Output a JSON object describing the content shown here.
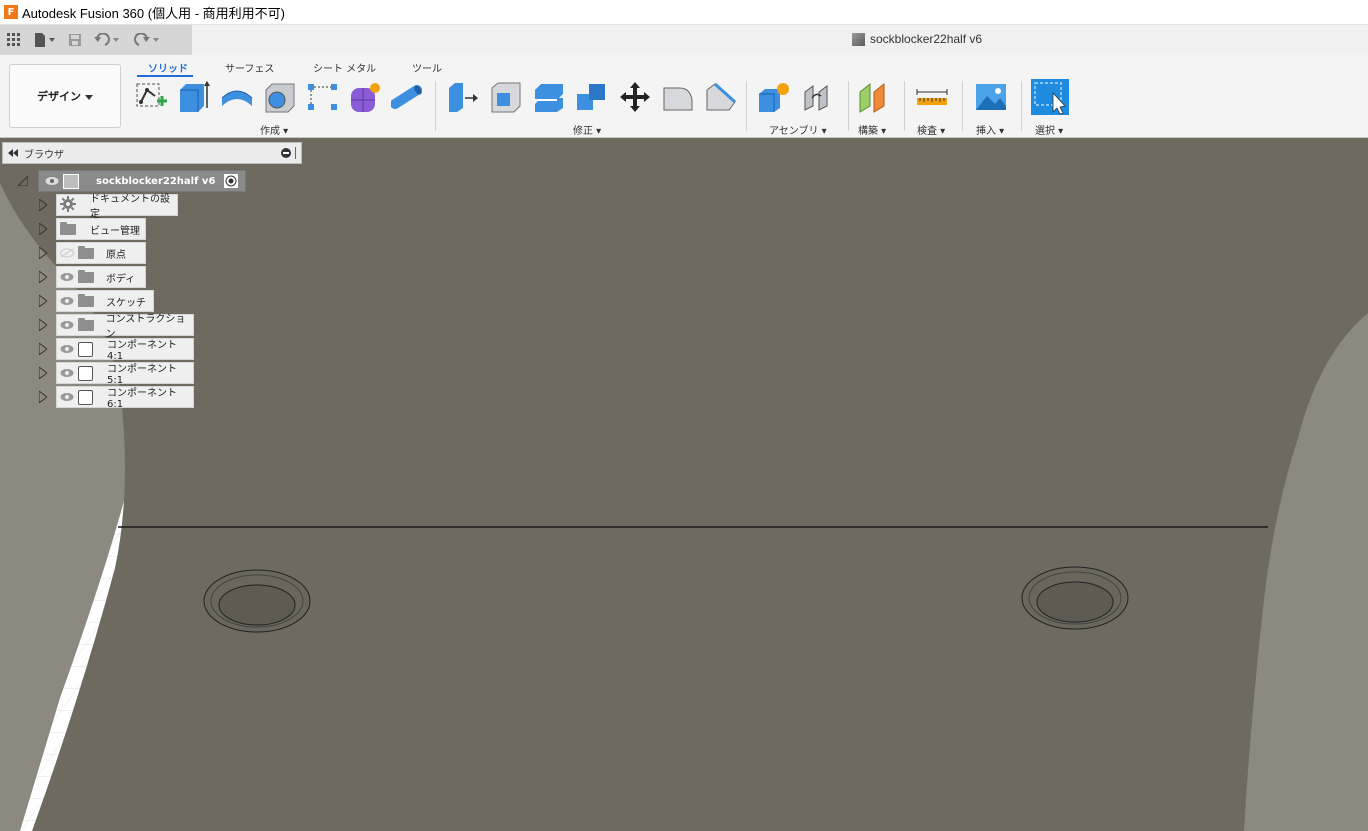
{
  "window": {
    "title": "Autodesk Fusion 360 (個人用 - 商用利用不可)",
    "logo_letter": "F"
  },
  "document_tab": {
    "name": "sockblocker22half v6"
  },
  "workspace": {
    "label": "デザイン"
  },
  "ribbon_tabs": [
    {
      "label": "ソリッド",
      "active": true
    },
    {
      "label": "サーフェス",
      "active": false
    },
    {
      "label": "シート メタル",
      "active": false
    },
    {
      "label": "ツール",
      "active": false
    }
  ],
  "ribbon_groups": {
    "create": "作成",
    "modify": "修正",
    "assemble": "アセンブリ",
    "construct": "構築",
    "inspect": "検査",
    "insert": "挿入",
    "select": "選択"
  },
  "browser": {
    "title": "ブラウザ",
    "root": "sockblocker22half v6",
    "items": [
      {
        "label": "ドキュメントの設定",
        "icon": "gear-icon"
      },
      {
        "label": "ビュー管理",
        "icon": "folder-icon"
      },
      {
        "label": "原点",
        "icon": "folder-icon"
      },
      {
        "label": "ボディ",
        "icon": "folder-icon"
      },
      {
        "label": "スケッチ",
        "icon": "folder-icon"
      },
      {
        "label": "コンストラクション",
        "icon": "folder-icon"
      },
      {
        "label": "コンポーネント4:1",
        "icon": "component-icon"
      },
      {
        "label": "コンポーネント5:1",
        "icon": "component-icon"
      },
      {
        "label": "コンポーネント6:1",
        "icon": "component-icon"
      }
    ]
  },
  "colors": {
    "accent": "#1f6fd1",
    "model_surface": "#6f6a60",
    "model_edge": "#8c8980"
  }
}
